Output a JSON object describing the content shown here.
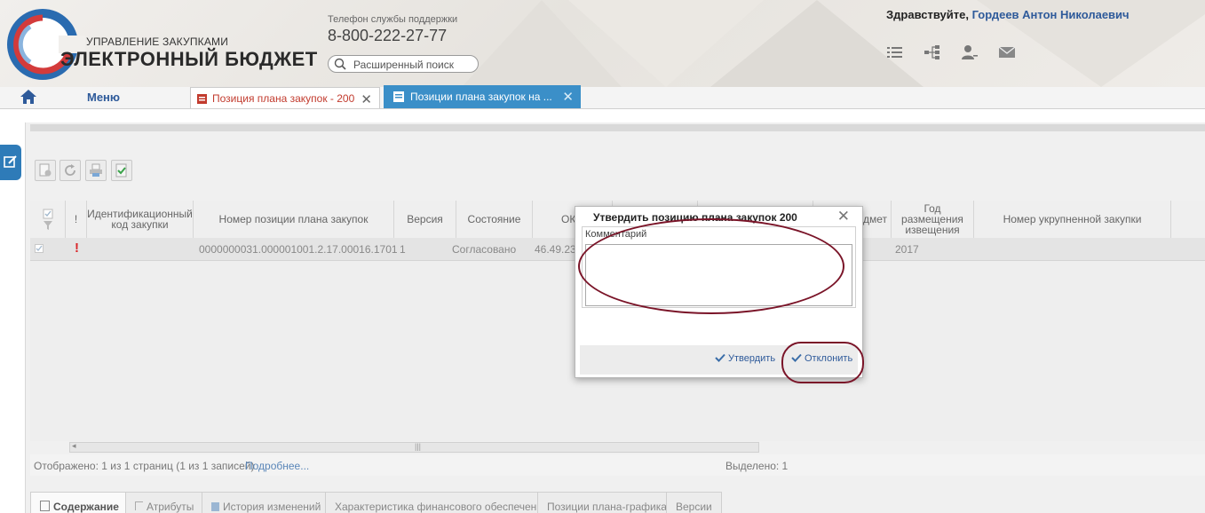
{
  "header": {
    "logo_top": "УПРАВЛЕНИЕ ЗАКУПКАМИ",
    "logo_bottom": "ЭЛЕКТРОННЫЙ БЮДЖЕТ",
    "support_label": "Телефон службы поддержки",
    "support_phone": "8-800-222-27-77",
    "search_placeholder": "Расширенный поиск",
    "greeting": "Здравствуйте,",
    "user_name": "Гордеев Антон Николаевич",
    "icons": [
      "list-icon",
      "hierarchy-icon",
      "users-icon",
      "mail-icon"
    ]
  },
  "tabs": {
    "home_icon": "home-icon",
    "menu_label": "Меню",
    "items": [
      {
        "label": "Позиция плана закупок - 200",
        "active": false
      },
      {
        "label": "Позиции плана закупок на ...",
        "active": true
      }
    ]
  },
  "toolbar": {
    "buttons": [
      "new-document-icon",
      "refresh-icon",
      "print-icon",
      "approve-icon"
    ]
  },
  "grid": {
    "columns": [
      "",
      "!",
      "Идентификационный код закупки",
      "Номер позиции плана закупок",
      "Версия",
      "Состояние",
      "ОКП",
      "",
      "",
      "Предмет",
      "Год размещения извещения",
      "Номер укрупненной закупки"
    ],
    "rows": [
      {
        "checked": true,
        "flag": "!",
        "code": "",
        "number": "0000000031.000001001.2.17.00016.1701",
        "version": "1",
        "state": "Согласовано",
        "okp": "46.49.23",
        "year": "2017",
        "consolidated": ""
      }
    ]
  },
  "status": {
    "displayed": "Отображено: 1 из 1 страниц (1 из 1 записей)",
    "more_link": "Подробнее...",
    "selected": "Выделено: 1"
  },
  "bottom_tabs": [
    "Содержание",
    "Атрибуты",
    "История изменений",
    "Характеристика финансового обеспечения",
    "Позиции плана-графика",
    "Версии"
  ],
  "dialog": {
    "title": "Утвердить позицию плана закупок 200",
    "comment_label": "Комментарий",
    "comment_value": "",
    "approve_label": "Утвердить",
    "reject_label": "Отклонить"
  },
  "colors": {
    "accent_blue": "#3b8fc8",
    "link_blue": "#2e5a9a",
    "annotation": "#7a1428",
    "alert_red": "#d9262a"
  }
}
